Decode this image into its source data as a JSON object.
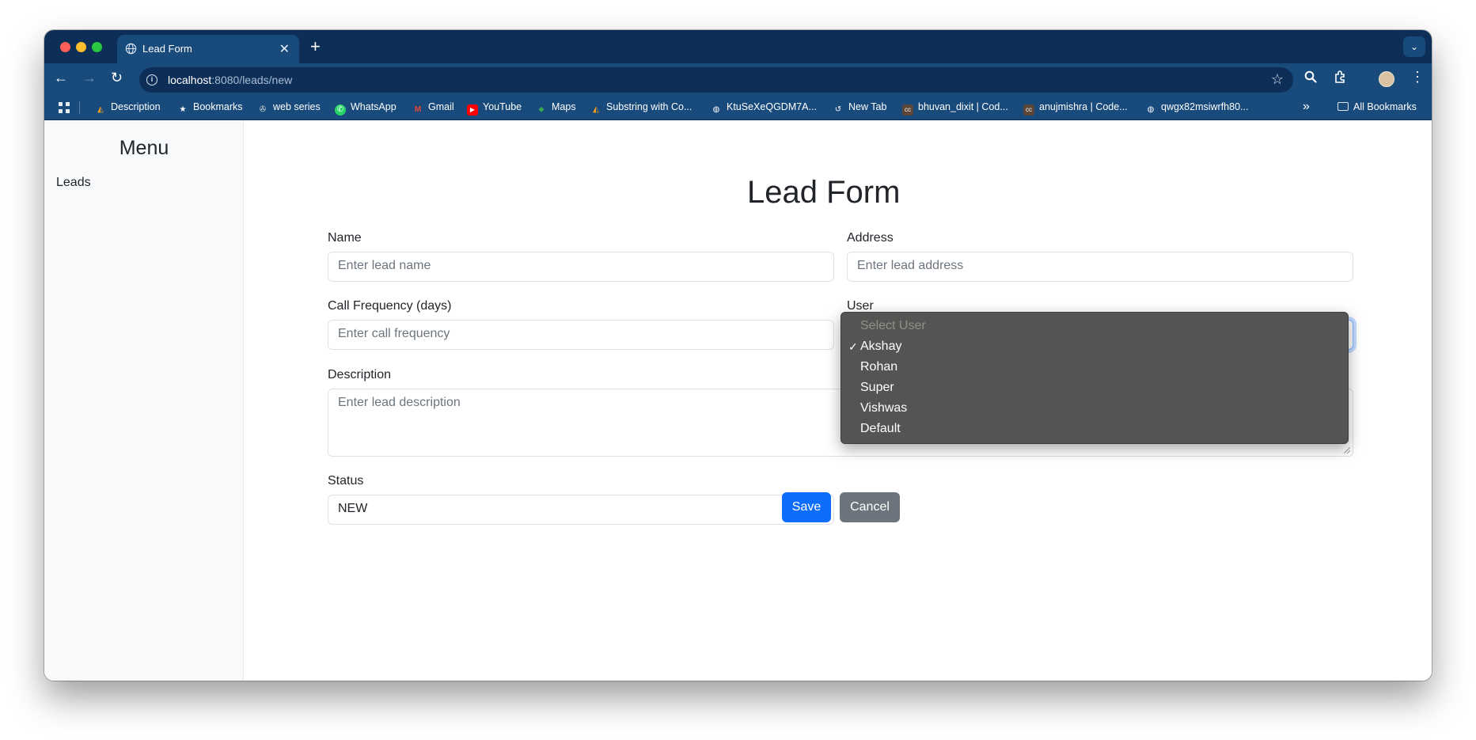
{
  "browser": {
    "tab_title": "Lead Form",
    "url_host": "localhost",
    "url_path": ":8080/leads/new",
    "bookmarks": [
      {
        "label": "Description",
        "icon": "leetcode-icon"
      },
      {
        "label": "Bookmarks",
        "icon": "star-icon"
      },
      {
        "label": "web series",
        "icon": "film-reel-icon"
      },
      {
        "label": "WhatsApp",
        "icon": "whatsapp-icon"
      },
      {
        "label": "Gmail",
        "icon": "gmail-icon"
      },
      {
        "label": "YouTube",
        "icon": "youtube-icon"
      },
      {
        "label": "Maps",
        "icon": "maps-pin-icon"
      },
      {
        "label": "Substring with Co...",
        "icon": "leetcode-icon"
      },
      {
        "label": "KtuSeXeQGDM7A...",
        "icon": "globe-icon"
      },
      {
        "label": "New Tab",
        "icon": "history-icon"
      },
      {
        "label": "bhuvan_dixit | Cod...",
        "icon": "codechef-icon"
      },
      {
        "label": "anujmishra | Code...",
        "icon": "codechef-icon"
      },
      {
        "label": "qwgx82msiwrfh80...",
        "icon": "globe-icon"
      }
    ],
    "all_bookmarks_label": "All Bookmarks"
  },
  "sidebar": {
    "title": "Menu",
    "items": [
      {
        "label": "Leads"
      }
    ]
  },
  "form": {
    "title": "Lead Form",
    "name": {
      "label": "Name",
      "placeholder": "Enter lead name"
    },
    "address": {
      "label": "Address",
      "placeholder": "Enter lead address"
    },
    "call_frequency": {
      "label": "Call Frequency (days)",
      "placeholder": "Enter call frequency"
    },
    "user": {
      "label": "User"
    },
    "description": {
      "label": "Description",
      "placeholder": "Enter lead description"
    },
    "status": {
      "label": "Status",
      "value": "NEW"
    },
    "save_label": "Save",
    "cancel_label": "Cancel"
  },
  "user_dropdown": {
    "options": [
      {
        "label": "Select User",
        "disabled": true,
        "checked": false
      },
      {
        "label": "Akshay",
        "disabled": false,
        "checked": true
      },
      {
        "label": "Rohan",
        "disabled": false,
        "checked": false
      },
      {
        "label": "Super",
        "disabled": false,
        "checked": false
      },
      {
        "label": "Vishwas",
        "disabled": false,
        "checked": false
      },
      {
        "label": "Default",
        "disabled": false,
        "checked": false
      }
    ],
    "check_glyph": "✓"
  },
  "colors": {
    "primary": "#0d6efd",
    "secondary": "#6c757d",
    "browser_frame": "#0d2f57",
    "browser_toolbar": "#184a7c"
  }
}
